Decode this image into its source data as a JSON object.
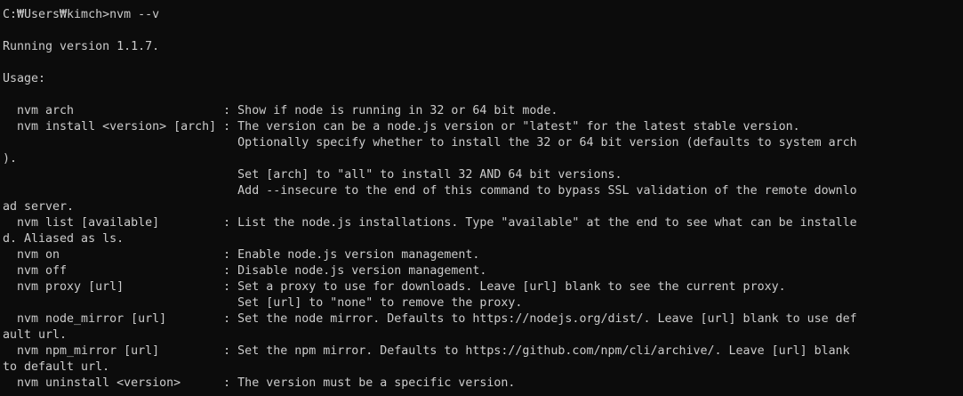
{
  "terminal": {
    "prompt": "C:₩Users₩kimch>nvm --v",
    "lines": [
      "Running version 1.1.7.",
      "Usage:",
      "  nvm arch                     : Show if node is running in 32 or 64 bit mode.",
      "  nvm install <version> [arch] : The version can be a node.js version or \"latest\" for the latest stable version.",
      "                                 Optionally specify whether to install the 32 or 64 bit version (defaults to system arch",
      ").",
      "                                 Set [arch] to \"all\" to install 32 AND 64 bit versions.",
      "                                 Add --insecure to the end of this command to bypass SSL validation of the remote downlo",
      "ad server.",
      "  nvm list [available]         : List the node.js installations. Type \"available\" at the end to see what can be installe",
      "d. Aliased as ls.",
      "  nvm on                       : Enable node.js version management.",
      "  nvm off                      : Disable node.js version management.",
      "  nvm proxy [url]              : Set a proxy to use for downloads. Leave [url] blank to see the current proxy.",
      "                                 Set [url] to \"none\" to remove the proxy.",
      "  nvm node_mirror [url]        : Set the node mirror. Defaults to https://nodejs.org/dist/. Leave [url] blank to use def",
      "ault url.",
      "  nvm npm_mirror [url]         : Set the npm mirror. Defaults to https://github.com/npm/cli/archive/. Leave [url] blank",
      "to default url.",
      "  nvm uninstall <version>      : The version must be a specific version."
    ]
  }
}
